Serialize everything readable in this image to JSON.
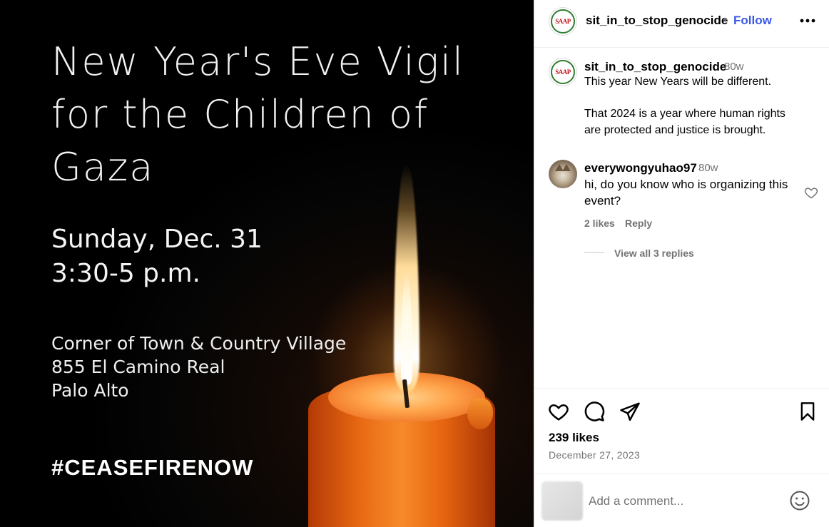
{
  "image": {
    "title_lines": [
      "New Year's Eve Vigil",
      "for the Children of",
      "Gaza"
    ],
    "date_lines": [
      "Sunday, Dec. 31",
      "3:30-5 p.m."
    ],
    "address_lines": [
      "Corner of Town & Country Village",
      "855 El Camino Real",
      "Palo Alto"
    ],
    "hashtag": "#CEASEFIRENOW"
  },
  "header": {
    "username": "sit_in_to_stop_genocide",
    "separator": "•",
    "follow_label": "Follow",
    "more_label": "•••",
    "logo_text": "SAAP"
  },
  "caption": {
    "username": "sit_in_to_stop_genocide",
    "time": "80w",
    "line1": "This year New Years will be different.",
    "line2": "That 2024 is a year where human rights",
    "line3": "are protected and justice is brought."
  },
  "comment": {
    "username": "everywongyuhao97",
    "time": "80w",
    "line1": "hi, do you know who is organizing this",
    "line2": "event?",
    "likes": "2 likes",
    "reply_label": "Reply",
    "view_replies": "View all 3 replies"
  },
  "actions": {
    "likes_count": "239 likes",
    "date": "December 27, 2023"
  },
  "comment_input": {
    "placeholder": "Add a comment..."
  },
  "icons": [
    "more-icon",
    "heart-icon",
    "comment-icon",
    "share-icon",
    "bookmark-icon",
    "emoji-icon"
  ],
  "colors": {
    "follow": "#3a58e8",
    "muted": "#737373"
  }
}
